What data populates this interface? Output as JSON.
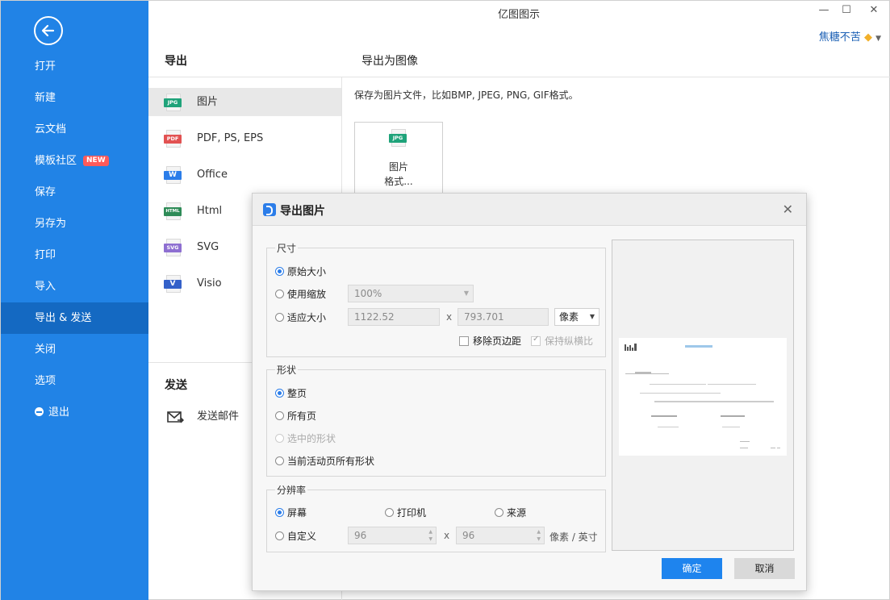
{
  "window": {
    "title": "亿图图示",
    "user": "焦糖不苦"
  },
  "sidebar": {
    "items": [
      {
        "label": "打开"
      },
      {
        "label": "新建"
      },
      {
        "label": "云文档"
      },
      {
        "label": "模板社区",
        "badge": "NEW"
      },
      {
        "label": "保存"
      },
      {
        "label": "另存为"
      },
      {
        "label": "打印"
      },
      {
        "label": "导入"
      },
      {
        "label": "导出 & 发送",
        "active": true
      },
      {
        "label": "关闭"
      },
      {
        "label": "选项"
      },
      {
        "label": "退出"
      }
    ]
  },
  "export": {
    "heading": "导出",
    "formats": [
      {
        "label": "图片",
        "icon": "JPG",
        "color": "#1fa37a",
        "active": true
      },
      {
        "label": "PDF, PS, EPS",
        "icon": "PDF",
        "color": "#e25252"
      },
      {
        "label": "Office",
        "icon": "W",
        "color": "#2b7de9"
      },
      {
        "label": "Html",
        "icon": "HTML",
        "color": "#2e8b57"
      },
      {
        "label": "SVG",
        "icon": "SVG",
        "color": "#8e6fd1"
      },
      {
        "label": "Visio",
        "icon": "V",
        "color": "#3461c9"
      }
    ],
    "send_heading": "发送",
    "send_mail": "发送邮件"
  },
  "detail": {
    "heading": "导出为图像",
    "description": "保存为图片文件，比如BMP, JPEG, PNG, GIF格式。",
    "tile_icon": "JPG",
    "tile_label_line1": "图片",
    "tile_label_line2": "格式..."
  },
  "dialog": {
    "title": "导出图片",
    "size_group": "尺寸",
    "size_original": "原始大小",
    "size_scale": "使用缩放",
    "scale_value": "100%",
    "size_fit": "适应大小",
    "width": "1122.52",
    "height": "793.701",
    "unit": "像素",
    "remove_margin": "移除页边距",
    "keep_ratio": "保持纵横比",
    "shape_group": "形状",
    "shape_whole_page": "整页",
    "shape_all_pages": "所有页",
    "shape_selected": "选中的形状",
    "shape_current_page": "当前活动页所有形状",
    "resolution_group": "分辨率",
    "res_screen": "屏幕",
    "res_printer": "打印机",
    "res_source": "来源",
    "res_custom": "自定义",
    "dpi_x": "96",
    "dpi_y": "96",
    "dpi_unit": "像素 / 英寸",
    "ok": "确定",
    "cancel": "取消",
    "x_sep": "x"
  }
}
